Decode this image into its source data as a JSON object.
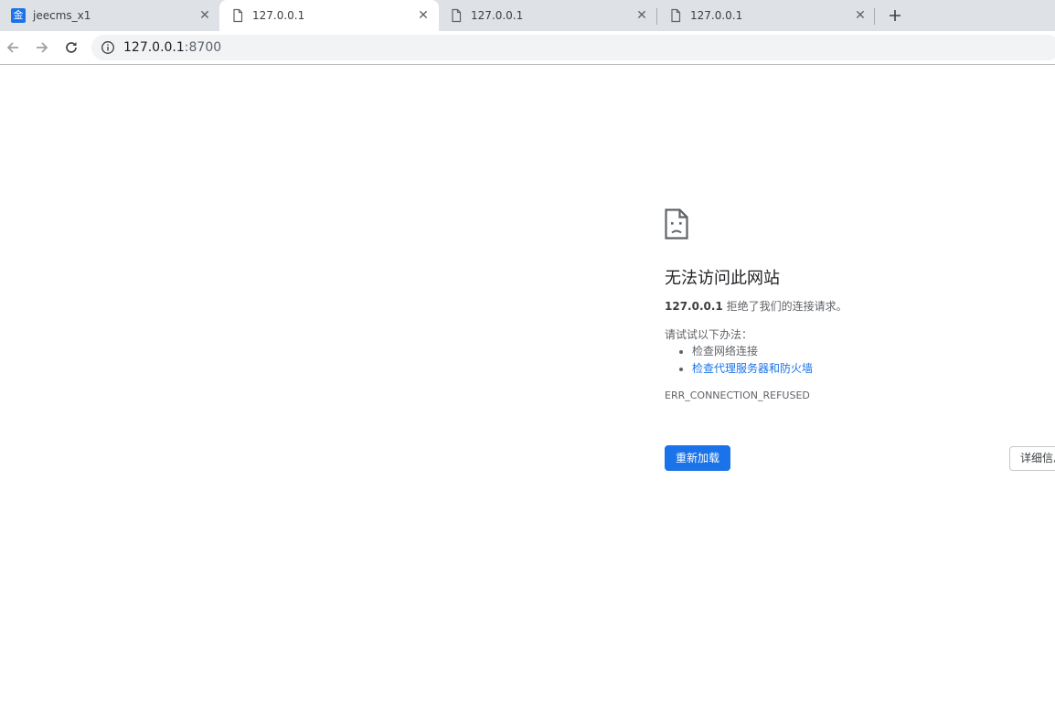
{
  "tabs": [
    {
      "title": "jeecms_x1",
      "favicon": "jeecms-favicon",
      "favicon_text": "金",
      "active": false
    },
    {
      "title": "127.0.0.1",
      "favicon": "page-icon",
      "active": true
    },
    {
      "title": "127.0.0.1",
      "favicon": "page-icon",
      "active": false
    },
    {
      "title": "127.0.0.1",
      "favicon": "page-icon",
      "active": false
    }
  ],
  "toolbar": {
    "back_icon": "back-arrow-icon",
    "forward_icon": "forward-arrow-icon",
    "reload_icon": "reload-icon",
    "new_tab_icon": "plus-icon"
  },
  "omnibox": {
    "host": "127.0.0.1",
    "port": ":8700",
    "info_icon": "info-icon"
  },
  "error_page": {
    "icon": "sad-page-icon",
    "title": "无法访问此网站",
    "host": "127.0.0.1",
    "description": " 拒绝了我们的连接请求。",
    "suggestions_heading": "请试试以下办法：",
    "suggestions": [
      {
        "text": "检查网络连接",
        "link": false
      },
      {
        "text": "检查代理服务器和防火墙",
        "link": true
      }
    ],
    "error_code": "ERR_CONNECTION_REFUSED",
    "reload_button": "重新加载",
    "details_button": "详细信息"
  },
  "colors": {
    "accent": "#1a73e8",
    "tabstrip": "#dee1e6",
    "omnibox": "#f1f3f4"
  }
}
